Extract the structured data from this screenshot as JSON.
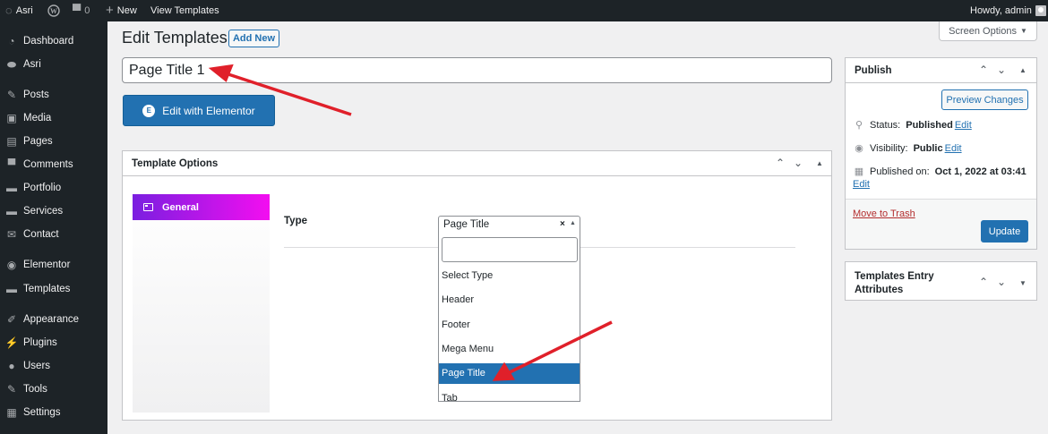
{
  "admin_bar": {
    "site_name": "Asri",
    "comments_count": "0",
    "new_label": "New",
    "view_templates_label": "View Templates",
    "greeting": "Howdy, admin"
  },
  "sidebar": {
    "items": [
      {
        "label": "Dashboard",
        "icon": "dashboard-icon"
      },
      {
        "label": "Asri",
        "icon": "toggle-icon"
      },
      {
        "label": "Posts",
        "icon": "pin-icon"
      },
      {
        "label": "Media",
        "icon": "media-icon"
      },
      {
        "label": "Pages",
        "icon": "pages-icon"
      },
      {
        "label": "Comments",
        "icon": "comment-icon"
      },
      {
        "label": "Portfolio",
        "icon": "folder-icon"
      },
      {
        "label": "Services",
        "icon": "folder-icon"
      },
      {
        "label": "Contact",
        "icon": "mail-icon"
      },
      {
        "label": "Elementor",
        "icon": "elementor-icon"
      },
      {
        "label": "Templates",
        "icon": "folder-icon"
      },
      {
        "label": "Appearance",
        "icon": "brush-icon"
      },
      {
        "label": "Plugins",
        "icon": "plugin-icon"
      },
      {
        "label": "Users",
        "icon": "user-icon"
      },
      {
        "label": "Tools",
        "icon": "wrench-icon"
      },
      {
        "label": "Settings",
        "icon": "settings-icon"
      }
    ]
  },
  "header": {
    "title": "Edit Templates",
    "add_new_label": "Add New",
    "screen_options_label": "Screen Options"
  },
  "editor": {
    "post_title": "Page Title 1",
    "elementor_button_label": "Edit with Elementor"
  },
  "template_options": {
    "title": "Template Options",
    "tab_label": "General",
    "type_label": "Type",
    "selected_value": "Page Title",
    "options": [
      "Select Type",
      "Header",
      "Footer",
      "Mega Menu",
      "Page Title",
      "Tab"
    ],
    "highlighted_index": 4
  },
  "publish": {
    "title": "Publish",
    "preview_label": "Preview Changes",
    "status_label": "Status:",
    "status_value": "Published",
    "visibility_label": "Visibility:",
    "visibility_value": "Public",
    "published_label": "Published on:",
    "published_value": "Oct 1, 2022 at 03:41",
    "edit_label": "Edit",
    "trash_label": "Move to Trash",
    "update_label": "Update"
  },
  "attributes_box": {
    "title_line1": "Templates Entry",
    "title_line2": "Attributes"
  },
  "colors": {
    "admin_dark": "#1d2327",
    "accent_blue": "#2271b1",
    "annotation_red": "#e0202a",
    "tab_gradient_start": "#7a1fe0",
    "tab_gradient_end": "#f30ef0"
  }
}
